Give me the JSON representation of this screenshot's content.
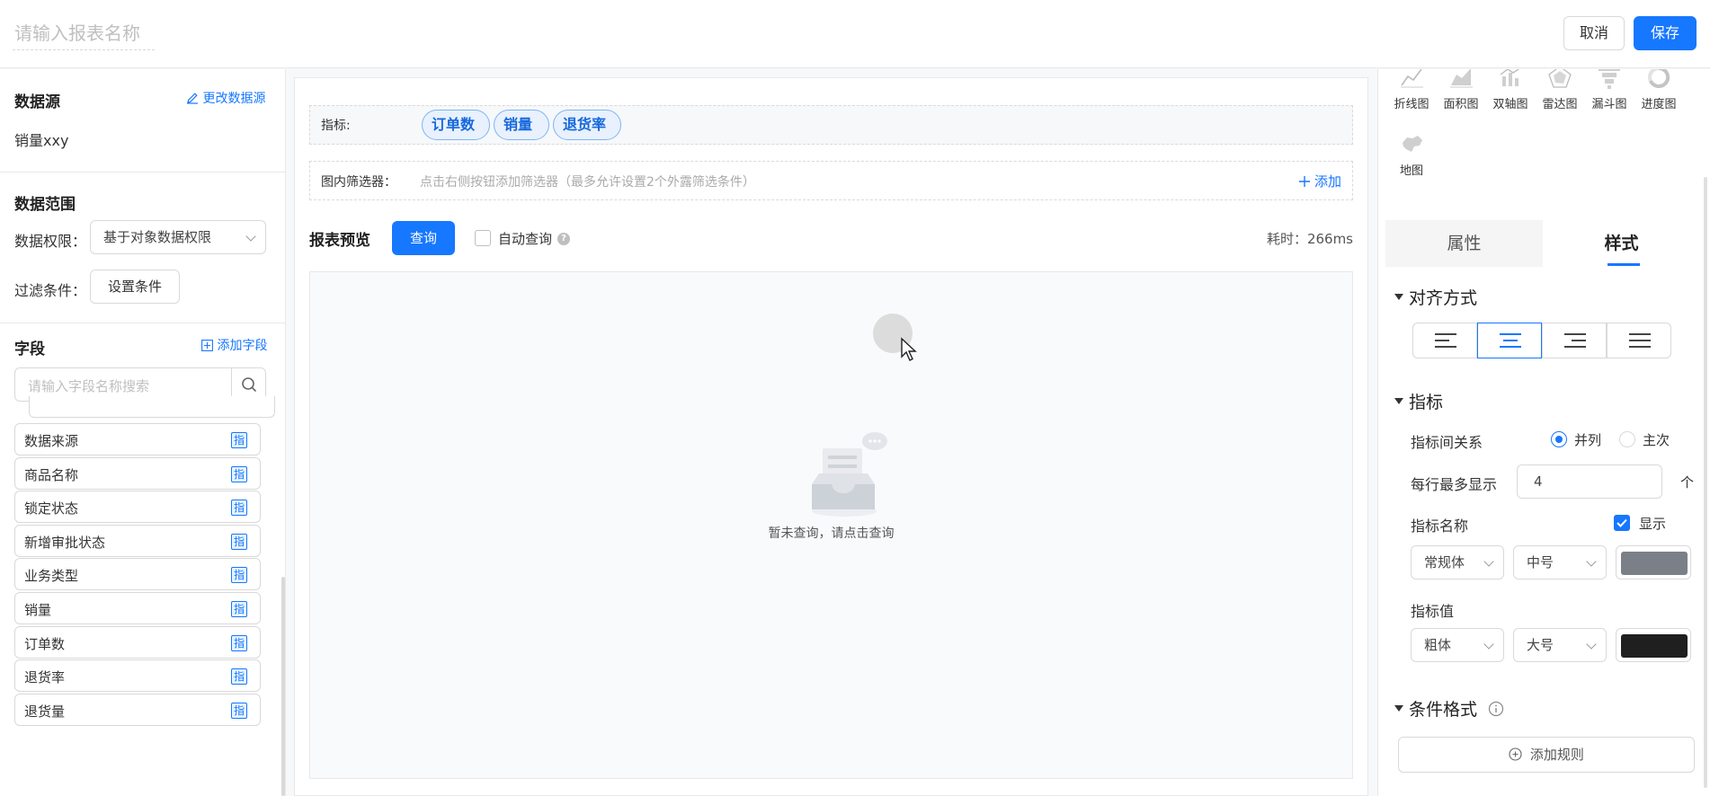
{
  "header": {
    "title_placeholder": "请输入报表名称",
    "cancel_label": "取消",
    "save_label": "保存"
  },
  "datasource": {
    "title": "数据源",
    "change_label": "更改数据源",
    "name": "销量xxy"
  },
  "data_range": {
    "title": "数据范围",
    "permission_label": "数据权限：",
    "permission_value": "基于对象数据权限",
    "filter_label": "过滤条件：",
    "filter_button": "设置条件"
  },
  "fields": {
    "title": "字段",
    "add_label": "添加字段",
    "search_placeholder": "请输入字段名称搜索",
    "tag": "指",
    "items": [
      {
        "label": "数据来源"
      },
      {
        "label": "商品名称"
      },
      {
        "label": "锁定状态"
      },
      {
        "label": "新增审批状态"
      },
      {
        "label": "业务类型"
      },
      {
        "label": "销量"
      },
      {
        "label": "订单数"
      },
      {
        "label": "退货率"
      },
      {
        "label": "退货量"
      }
    ]
  },
  "metrics_row": {
    "label": "指标:",
    "chips": [
      {
        "label": "订单数"
      },
      {
        "label": "销量"
      },
      {
        "label": "退货率"
      }
    ]
  },
  "filter_row": {
    "label": "图内筛选器：",
    "hint": "点击右侧按钮添加筛选器（最多允许设置2个外露筛选条件）",
    "add_label": "添加"
  },
  "preview": {
    "title": "报表预览",
    "query_button": "查询",
    "auto_query_label": "自动查询",
    "elapsed": "耗时：266ms",
    "empty_text": "暂未查询，请点击查询"
  },
  "chart_types": [
    {
      "label": "折线图",
      "icon": "line-chart-icon"
    },
    {
      "label": "面积图",
      "icon": "area-chart-icon"
    },
    {
      "label": "双轴图",
      "icon": "dual-axis-chart-icon"
    },
    {
      "label": "雷达图",
      "icon": "radar-chart-icon"
    },
    {
      "label": "漏斗图",
      "icon": "funnel-chart-icon"
    },
    {
      "label": "进度图",
      "icon": "progress-chart-icon"
    },
    {
      "label": "地图",
      "icon": "map-chart-icon"
    }
  ],
  "tabs": {
    "properties": "属性",
    "style": "样式"
  },
  "style_panel": {
    "align_title": "对齐方式",
    "metric_title": "指标",
    "relation_label": "指标间关系",
    "relation_option_1": "并列",
    "relation_option_2": "主次",
    "per_row_label": "每行最多显示",
    "per_row_value": "4",
    "per_row_unit": "个",
    "name_label": "指标名称",
    "show_label": "显示",
    "name_font": "常规体",
    "name_size": "中号",
    "value_label": "指标值",
    "value_font": "粗体",
    "value_size": "大号",
    "cond_title": "条件格式",
    "add_rule": "添加规则"
  },
  "colors": {
    "accent": "#1677ff",
    "name_color": "#7b8088",
    "value_color": "#1f1f1f"
  }
}
